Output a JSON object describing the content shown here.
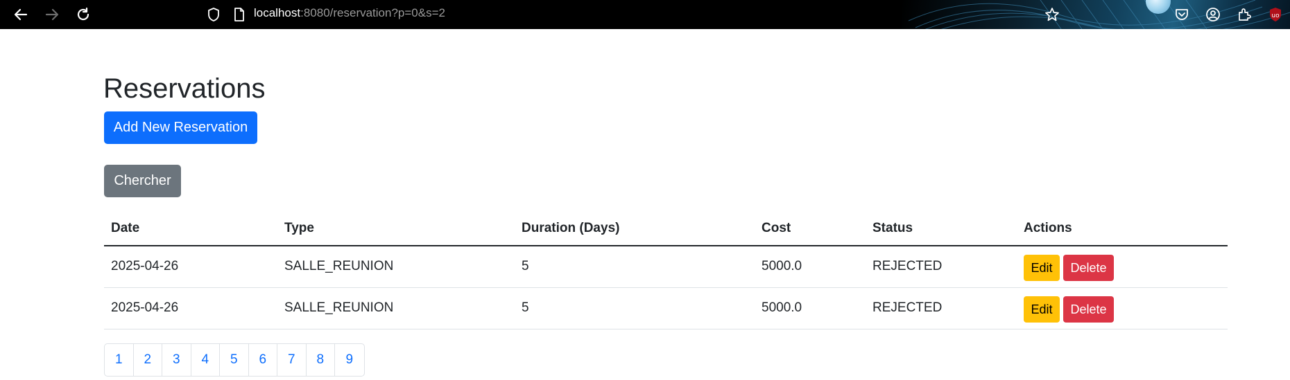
{
  "browser": {
    "url_host": "localhost",
    "url_rest": ":8080/reservation?p=0&s=2"
  },
  "page": {
    "title": "Reservations",
    "add_button_label": "Add New Reservation",
    "search_button_label": "Chercher"
  },
  "table": {
    "headers": {
      "date": "Date",
      "type": "Type",
      "duration": "Duration (Days)",
      "cost": "Cost",
      "status": "Status",
      "actions": "Actions"
    },
    "rows": [
      {
        "date": "2025-04-26",
        "type": "SALLE_REUNION",
        "duration": "5",
        "cost": "5000.0",
        "status": "REJECTED",
        "edit_label": "Edit",
        "delete_label": "Delete"
      },
      {
        "date": "2025-04-26",
        "type": "SALLE_REUNION",
        "duration": "5",
        "cost": "5000.0",
        "status": "REJECTED",
        "edit_label": "Edit",
        "delete_label": "Delete"
      }
    ]
  },
  "pagination": {
    "pages": [
      "1",
      "2",
      "3",
      "4",
      "5",
      "6",
      "7",
      "8",
      "9"
    ]
  },
  "colors": {
    "primary": "#0d6efd",
    "secondary": "#6c757d",
    "warning": "#ffc107",
    "danger": "#dc3545"
  }
}
